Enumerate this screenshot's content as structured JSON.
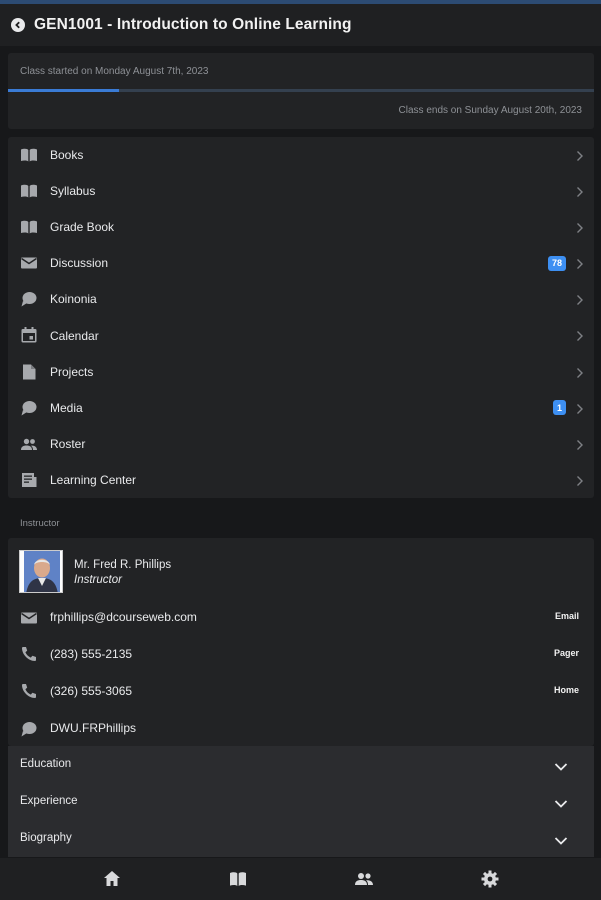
{
  "header": {
    "title": "GEN1001 - Introduction to Online Learning"
  },
  "progress": {
    "started": "Class started on Monday August 7th, 2023",
    "ends": "Class ends on Sunday August 20th, 2023",
    "fraction": 0.19,
    "accent": "#3a7bd5"
  },
  "menu": [
    {
      "label": "Books",
      "icon": "book-icon"
    },
    {
      "label": "Syllabus",
      "icon": "book-icon"
    },
    {
      "label": "Grade Book",
      "icon": "book-icon"
    },
    {
      "label": "Discussion",
      "icon": "mail-icon",
      "badge": "78"
    },
    {
      "label": "Koinonia",
      "icon": "chat-icon"
    },
    {
      "label": "Calendar",
      "icon": "calendar-icon"
    },
    {
      "label": "Projects",
      "icon": "document-icon"
    },
    {
      "label": "Media",
      "icon": "chat-icon",
      "badge": "1"
    },
    {
      "label": "Roster",
      "icon": "people-icon"
    },
    {
      "label": "Learning Center",
      "icon": "news-icon"
    }
  ],
  "instructor": {
    "section_label": "Instructor",
    "name": "Mr. Fred R. Phillips",
    "role": "Instructor",
    "contacts": [
      {
        "icon": "mail-icon",
        "value": "frphillips@dcourseweb.com",
        "type": "Email"
      },
      {
        "icon": "phone-icon",
        "value": "(283) 555-2135",
        "type": "Pager"
      },
      {
        "icon": "phone-icon",
        "value": "(326) 555-3065",
        "type": "Home"
      },
      {
        "icon": "chat-icon",
        "value": "DWU.FRPhillips",
        "type": ""
      }
    ]
  },
  "accordions": [
    {
      "label": "Education"
    },
    {
      "label": "Experience"
    },
    {
      "label": "Biography"
    }
  ],
  "bottom_nav": [
    "home-icon",
    "book-icon",
    "people-icon",
    "gear-icon"
  ]
}
